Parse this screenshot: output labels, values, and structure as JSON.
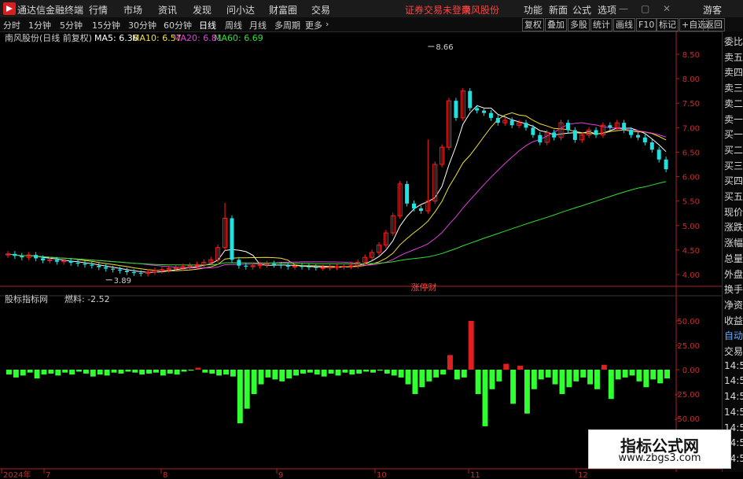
{
  "titlebar": {
    "app_name": "通达信金融终端",
    "menu": [
      "行情",
      "市场",
      "资讯",
      "发现",
      "问小达",
      "财富圈",
      "交易"
    ],
    "warning": "证券交易未登录",
    "stock": "南风股份",
    "right_menu": [
      "功能",
      "新面",
      "公式",
      "选项"
    ],
    "guest": "游客"
  },
  "toolbar": {
    "periods": [
      "分时",
      "1分钟",
      "5分钟",
      "15分钟",
      "30分钟",
      "60分钟",
      "日线",
      "周线",
      "月线",
      "多周期",
      "更多"
    ],
    "active_period": "日线",
    "right_buttons": [
      "复权",
      "叠加",
      "多股",
      "统计",
      "画线",
      "F10",
      "标记",
      "+自选",
      "返回"
    ]
  },
  "main_chart": {
    "header_name": "南风股份(日线 前复权)",
    "ma_labels": [
      "MA5: 6.36",
      "MA10: 6.57",
      "MA20: 6.81",
      "MA60: 6.69"
    ],
    "ma_colors": [
      "#ffffff",
      "#f0e030",
      "#e040e0",
      "#30e030"
    ],
    "high_label": "8.66",
    "low_label": "3.89",
    "event_label": "涨停财",
    "y_ticks": [
      "8.50",
      "8.00",
      "7.50",
      "7.00",
      "6.50",
      "6.00",
      "5.50",
      "5.00",
      "4.50",
      "4.00"
    ]
  },
  "indicator": {
    "header_name": "股标指标网",
    "header_value": "燃料: -2.52",
    "y_ticks": [
      "50.00",
      "25.00",
      "0.00",
      "-25.00",
      "-50.00"
    ]
  },
  "x_axis": {
    "labels": [
      "2024年",
      "7",
      "8",
      "9",
      "10",
      "11",
      "12"
    ]
  },
  "sidebar": {
    "items": [
      "委比",
      "卖五",
      "卖四",
      "卖三",
      "卖二",
      "卖一",
      "买一",
      "买二",
      "买三",
      "买四",
      "买五",
      "现价",
      "涨跌",
      "涨幅",
      "总量",
      "外盘",
      "换手",
      "净资",
      "收益",
      "自动",
      "交易",
      "14:50",
      "14:50",
      "14:50",
      "14:50",
      "14:50",
      "14:50",
      "14:50"
    ]
  },
  "watermark": {
    "title": "指标公式网",
    "url": "www.zbgs3.com"
  },
  "colors": {
    "up": "#ff2020",
    "down": "#20e0e0",
    "pos_bar": "#e02020",
    "neg_bar": "#30ff30",
    "axis": "#b02020"
  },
  "chart_data": [
    {
      "type": "candlestick",
      "title": "南风股份(日线 前复权)",
      "ylim": [
        3.8,
        8.7
      ],
      "periods": [
        "2024-07",
        "2024-08",
        "2024-09",
        "2024-10",
        "2024-11",
        "2024-12"
      ],
      "close": [
        4.42,
        4.38,
        4.35,
        4.4,
        4.33,
        4.29,
        4.3,
        4.26,
        4.28,
        4.24,
        4.22,
        4.2,
        4.18,
        4.15,
        4.12,
        4.1,
        4.08,
        4.05,
        4.03,
        4.02,
        4.05,
        4.08,
        4.1,
        4.12,
        4.14,
        4.16,
        4.18,
        4.2,
        4.25,
        4.3,
        4.55,
        5.15,
        4.3,
        4.18,
        4.16,
        4.18,
        4.2,
        4.22,
        4.2,
        4.18,
        4.16,
        4.17,
        4.16,
        4.15,
        4.14,
        4.14,
        4.15,
        4.16,
        4.17,
        4.18,
        4.25,
        4.35,
        4.45,
        4.6,
        4.85,
        5.2,
        5.85,
        5.45,
        5.35,
        5.3,
        5.5,
        6.25,
        6.6,
        7.55,
        7.2,
        7.75,
        7.4,
        7.35,
        7.3,
        7.2,
        7.1,
        7.15,
        7.05,
        7.1,
        7.0,
        6.85,
        6.7,
        6.9,
        6.8,
        7.1,
        6.95,
        6.75,
        6.85,
        6.95,
        6.85,
        7.05,
        7.0,
        7.1,
        6.95,
        6.85,
        6.8,
        6.7,
        6.55,
        6.35,
        6.15
      ],
      "ma_series": [
        "MA5",
        "MA10",
        "MA20",
        "MA60"
      ],
      "ma_last": [
        6.36,
        6.57,
        6.81,
        6.69
      ],
      "high_annotation": 8.66,
      "low_annotation": 3.89
    },
    {
      "type": "bar",
      "title": "股标指标网",
      "series_name": "燃料",
      "last_value": -2.52,
      "ylim": [
        -62,
        62
      ],
      "values": [
        -5,
        -8,
        -6,
        -3,
        -9,
        -5,
        -4,
        -6,
        -3,
        -5,
        -2,
        -4,
        -7,
        -5,
        -6,
        -3,
        -4,
        -2,
        -3,
        -5,
        -4,
        -3,
        -6,
        -4,
        -5,
        -2,
        -1,
        2,
        -3,
        -4,
        -6,
        -5,
        -7,
        -55,
        -40,
        -25,
        -15,
        -8,
        -10,
        -12,
        -9,
        -6,
        -4,
        -3,
        -5,
        -7,
        -4,
        -6,
        -3,
        -5,
        -4,
        -2,
        -3,
        -1,
        -4,
        -6,
        -8,
        -15,
        -25,
        -18,
        -12,
        -8,
        -5,
        15,
        -10,
        -8,
        50,
        -25,
        -58,
        -20,
        -12,
        6,
        -35,
        4,
        -45,
        -20,
        -10,
        -8,
        -15,
        -25,
        -18,
        -12,
        -8,
        -15,
        -20,
        5,
        -30,
        -10,
        -8,
        -6,
        -12,
        -18,
        -10,
        -14,
        -9
      ]
    }
  ]
}
